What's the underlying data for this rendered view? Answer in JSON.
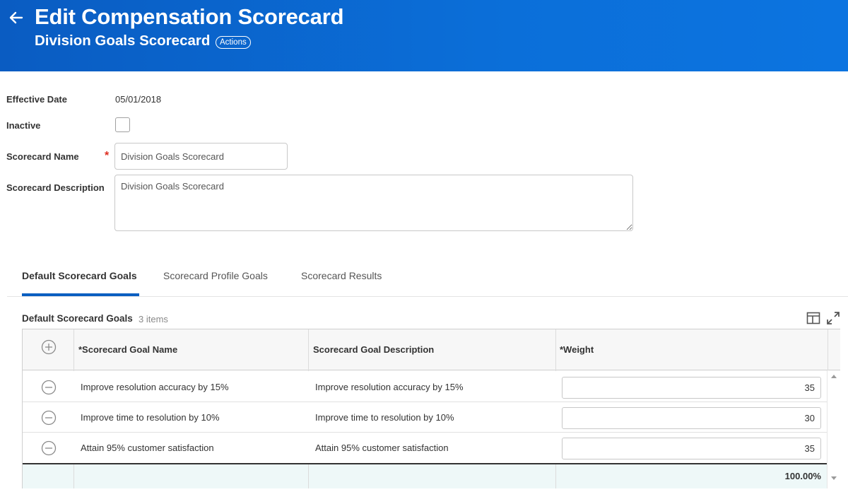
{
  "header": {
    "title": "Edit Compensation Scorecard",
    "subtitle": "Division Goals Scorecard",
    "actions_label": "Actions",
    "background_color": "#0b6fd9"
  },
  "form": {
    "effective_date": {
      "label": "Effective Date",
      "value": "05/01/2018"
    },
    "inactive": {
      "label": "Inactive",
      "checked": false
    },
    "scorecard_name": {
      "label": "Scorecard Name",
      "required_mark": "*",
      "value": "Division Goals Scorecard"
    },
    "scorecard_description": {
      "label": "Scorecard Description",
      "value": "Division Goals Scorecard"
    }
  },
  "tabs": [
    {
      "label": "Default Scorecard Goals",
      "active": true
    },
    {
      "label": "Scorecard Profile Goals",
      "active": false
    },
    {
      "label": "Scorecard Results",
      "active": false
    }
  ],
  "grid": {
    "title": "Default Scorecard Goals",
    "count": "3 items",
    "columns": [
      "*Scorecard Goal Name",
      "Scorecard Goal Description",
      "*Weight"
    ],
    "rows": [
      {
        "name": "Improve resolution accuracy by 15%",
        "description": "Improve resolution accuracy by 15%",
        "weight": "35"
      },
      {
        "name": "Improve time to resolution by 10%",
        "description": "Improve time to resolution by 10%",
        "weight": "30"
      },
      {
        "name": "Attain 95% customer satisfaction",
        "description": "Attain 95% customer satisfaction",
        "weight": "35"
      }
    ],
    "total_weight": "100.00%"
  },
  "icons": {
    "back": "arrow-left-icon",
    "add_row": "plus-circle-icon",
    "remove_row": "minus-circle-icon",
    "column_layout": "table-layout-icon",
    "expand": "expand-icon"
  },
  "colors": {
    "accent": "#0b5fc1",
    "required": "#de2e21",
    "total_row_bg": "#eef8f8"
  }
}
